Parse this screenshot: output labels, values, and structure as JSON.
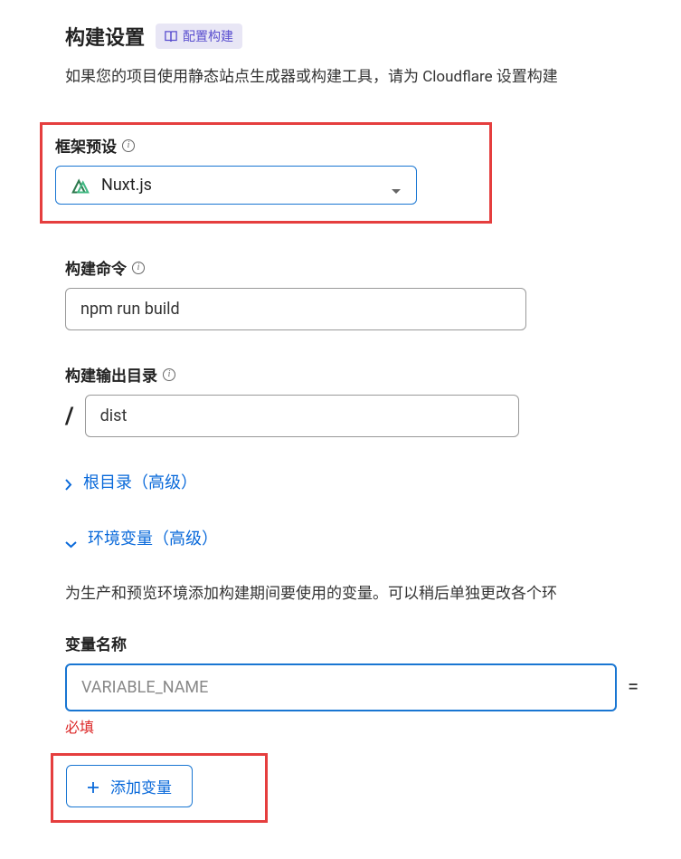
{
  "header": {
    "title": "构建设置",
    "badge_label": "配置构建"
  },
  "description": "如果您的项目使用静态站点生成器或构建工具，请为 Cloudflare 设置构建",
  "framework": {
    "label": "框架预设",
    "value": "Nuxt.js"
  },
  "build_command": {
    "label": "构建命令",
    "value": "npm run build"
  },
  "output_dir": {
    "label": "构建输出目录",
    "prefix": "/",
    "value": "dist"
  },
  "root_dir": {
    "label": "根目录（高级）"
  },
  "env_vars": {
    "header": "环境变量（高级）",
    "desc": "为生产和预览环境添加构建期间要使用的变量。可以稍后单独更改各个环",
    "var_name_label": "变量名称",
    "placeholder": "VARIABLE_NAME",
    "equals": "=",
    "error": "必填",
    "add_btn": "添加变量"
  }
}
